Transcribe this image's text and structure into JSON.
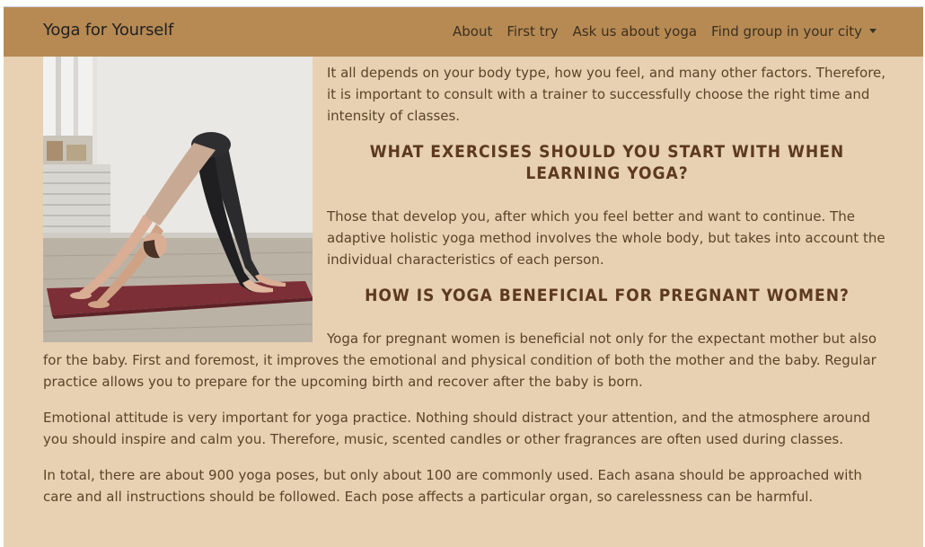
{
  "navbar": {
    "brand": "Yoga for Yourself",
    "links": [
      {
        "label": "About"
      },
      {
        "label": "First try"
      },
      {
        "label": "Ask us about yoga"
      },
      {
        "label": "Find group in your city"
      }
    ]
  },
  "image": {
    "alt": "Woman doing downward-facing dog pose on a burgundy yoga mat"
  },
  "article": {
    "p1": "It all depends on your body type, how you feel, and many other factors. Therefore, it is important to consult with a trainer to successfully choose the right time and intensity of classes.",
    "h1": "What exercises should you start with when learning yoga?",
    "p2": "Those that develop you, after which you feel better and want to continue. The adaptive holistic yoga method involves the whole body, but takes into account the individual characteristics of each person.",
    "h2": "How is yoga beneficial for pregnant women?",
    "p3": "Yoga for pregnant women is beneficial not only for the expectant mother but also for the baby. First and foremost, it improves the emotional and physical condition of both the mother and the baby. Regular practice allows you to prepare for the upcoming birth and recover after the baby is born.",
    "p4": "Emotional attitude is very important for yoga practice. Nothing should distract your attention, and the atmosphere around you should inspire and calm you. Therefore, music, scented candles or other fragrances are often used during classes.",
    "p5": "In total, there are about 900 yoga poses, but only about 100 are commonly used. Each asana should be approached with care and all instructions should be followed. Each pose affects a particular organ, so carelessness can be harmful."
  }
}
